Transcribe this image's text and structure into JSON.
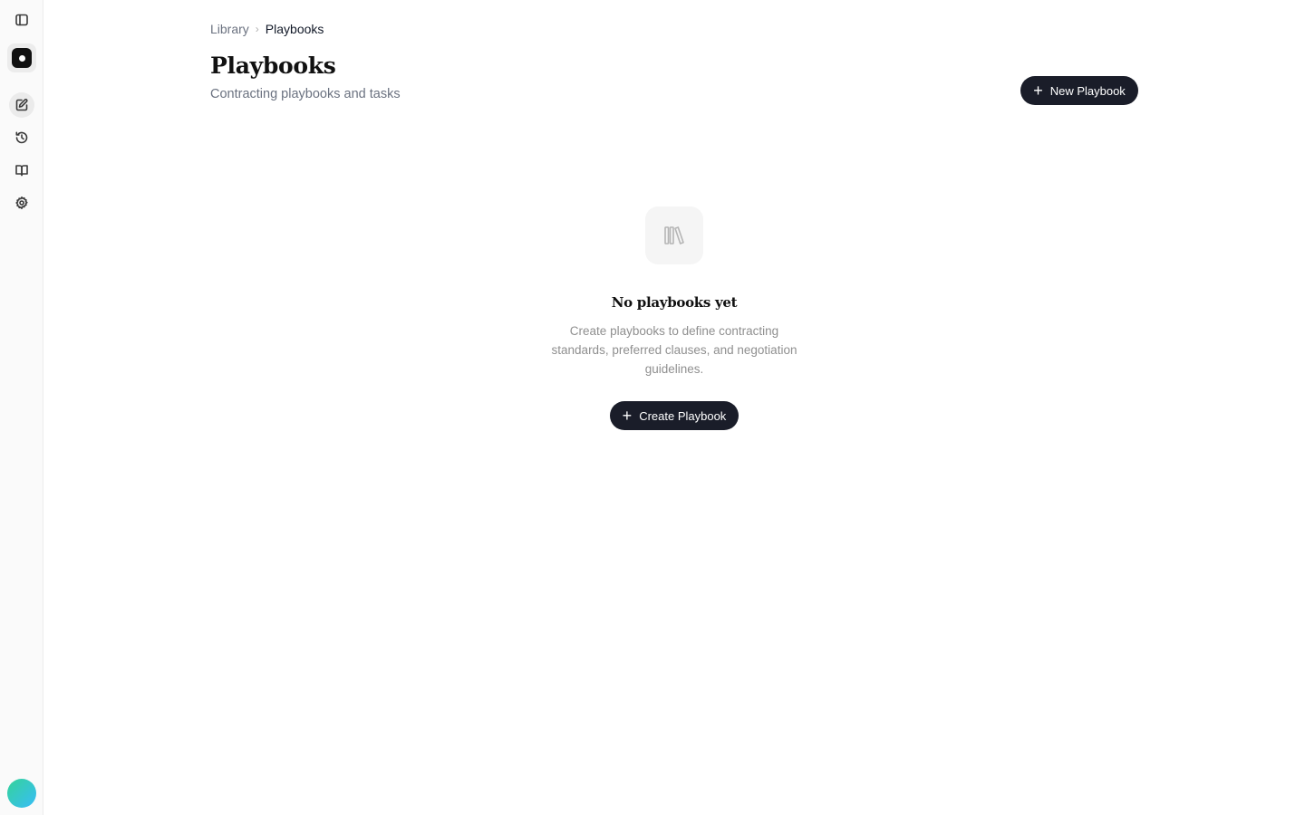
{
  "sidebar": {
    "items": [
      {
        "name": "toggle-sidebar",
        "icon": "sidebar-panel-icon"
      },
      {
        "name": "new",
        "icon": "pencil-square-icon",
        "active": true
      },
      {
        "name": "history",
        "icon": "history-clock-icon"
      },
      {
        "name": "library",
        "icon": "open-book-icon"
      },
      {
        "name": "settings",
        "icon": "gear-icon"
      }
    ],
    "brand_icon": "app-logo-icon",
    "avatar_colors": [
      "#34d399",
      "#38bdf8"
    ]
  },
  "breadcrumb": {
    "parent": "Library",
    "separator": "›",
    "current": "Playbooks"
  },
  "header": {
    "title": "Playbooks",
    "subtitle": "Contracting playbooks and tasks",
    "new_button_label": "New Playbook",
    "new_button_icon": "plus-icon"
  },
  "empty_state": {
    "icon": "books-icon",
    "title": "No playbooks yet",
    "description": "Create playbooks to define contracting standards, preferred clauses, and negotiation guidelines.",
    "button_label": "Create Playbook",
    "button_icon": "plus-icon"
  },
  "colors": {
    "primary_button": "#1a1d29",
    "muted_text": "#6b7280"
  }
}
